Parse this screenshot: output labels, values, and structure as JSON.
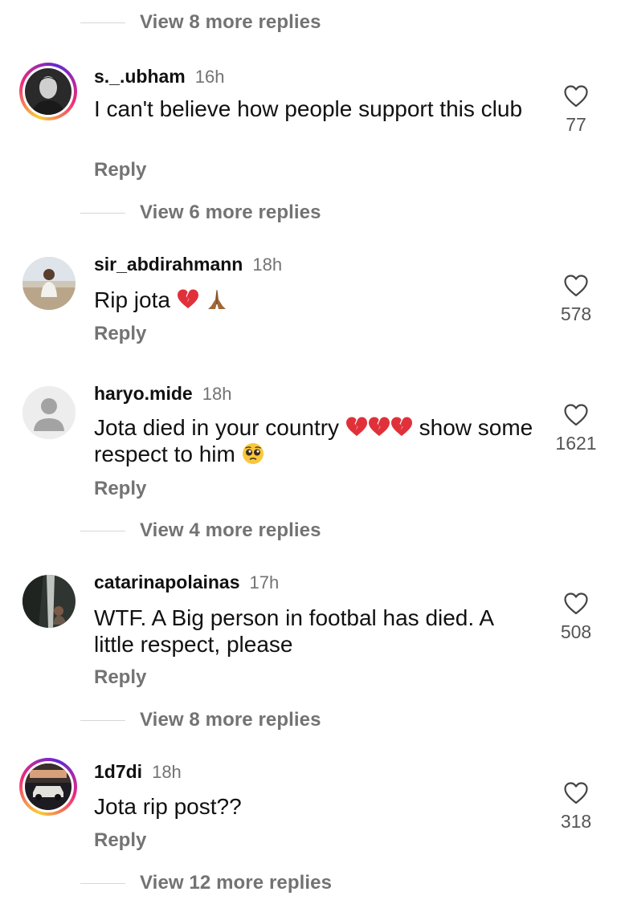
{
  "icons": {
    "heart": "heart-outline-icon",
    "default_avatar": "person-silhouette-icon"
  },
  "colors": {
    "ring_start": "#f9ce34",
    "ring_mid": "#ee2a7b",
    "ring_end": "#6228d7",
    "muted": "#737373"
  },
  "view_more": [
    "View 8 more replies",
    "View 6 more replies",
    "View 4 more replies",
    "View 8 more replies",
    "View 12 more replies"
  ],
  "reply_label": "Reply",
  "comments": [
    {
      "username": "s._.ubham",
      "time": "16h",
      "text": "I can't believe how people support this club",
      "likes": "77",
      "has_story": true
    },
    {
      "username": "sir_abdirahmann",
      "time": "18h",
      "text": "Rip jota",
      "likes": "578",
      "has_story": false
    },
    {
      "username": "haryo.mide",
      "time": "18h",
      "text_a": "Jota died in your country",
      "text_b": "show some respect to him",
      "likes": "1621",
      "has_story": false
    },
    {
      "username": "catarinapolainas",
      "time": "17h",
      "text": "WTF.  A Big person in footbal has died. A little respect, please",
      "likes": "508",
      "has_story": false
    },
    {
      "username": "1d7di",
      "time": "18h",
      "text": "Jota rip post??",
      "likes": "318",
      "has_story": true
    }
  ]
}
